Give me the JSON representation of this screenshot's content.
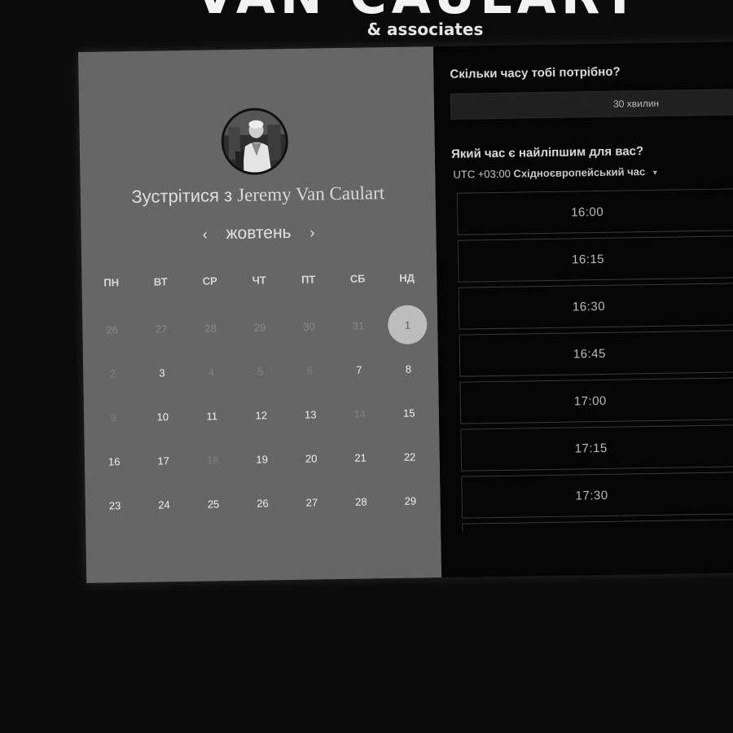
{
  "brand": {
    "title": "VAN CAULART",
    "subtitle": "& associates"
  },
  "booking": {
    "title_prefix": "Зустрітися з",
    "host_name": "Jeremy Van Caulart",
    "month": "жовтень",
    "prev_icon": "chevron-left-icon",
    "next_icon": "chevron-right-icon",
    "weekdays": [
      "ПН",
      "ВТ",
      "СР",
      "ЧТ",
      "ПТ",
      "СБ",
      "НД"
    ],
    "weeks": [
      [
        {
          "d": "26",
          "state": "muted"
        },
        {
          "d": "27",
          "state": "muted"
        },
        {
          "d": "28",
          "state": "muted"
        },
        {
          "d": "29",
          "state": "muted"
        },
        {
          "d": "30",
          "state": "muted"
        },
        {
          "d": "31",
          "state": "muted"
        },
        {
          "d": "1",
          "state": "selected"
        }
      ],
      [
        {
          "d": "2",
          "state": "disabled"
        },
        {
          "d": "3",
          "state": "available"
        },
        {
          "d": "4",
          "state": "disabled"
        },
        {
          "d": "5",
          "state": "disabled"
        },
        {
          "d": "6",
          "state": "disabled"
        },
        {
          "d": "7",
          "state": "available"
        },
        {
          "d": "8",
          "state": "available"
        }
      ],
      [
        {
          "d": "9",
          "state": "disabled"
        },
        {
          "d": "10",
          "state": "available"
        },
        {
          "d": "11",
          "state": "available"
        },
        {
          "d": "12",
          "state": "available"
        },
        {
          "d": "13",
          "state": "available"
        },
        {
          "d": "14",
          "state": "disabled"
        },
        {
          "d": "15",
          "state": "available"
        }
      ],
      [
        {
          "d": "16",
          "state": "available"
        },
        {
          "d": "17",
          "state": "available"
        },
        {
          "d": "18",
          "state": "disabled"
        },
        {
          "d": "19",
          "state": "available"
        },
        {
          "d": "20",
          "state": "available"
        },
        {
          "d": "21",
          "state": "available"
        },
        {
          "d": "22",
          "state": "available"
        }
      ],
      [
        {
          "d": "23",
          "state": "available"
        },
        {
          "d": "24",
          "state": "available"
        },
        {
          "d": "25",
          "state": "available"
        },
        {
          "d": "26",
          "state": "available"
        },
        {
          "d": "27",
          "state": "available"
        },
        {
          "d": "28",
          "state": "available"
        },
        {
          "d": "29",
          "state": "available"
        }
      ]
    ]
  },
  "scheduling": {
    "duration_question": "Скільки часу тобі потрібно?",
    "duration_value": "30 хвилин",
    "time_question": "Який час є найліпшим для вас?",
    "tz_offset": "UTC +03:00",
    "tz_name": "Східноєвропейський час",
    "tz_caret_icon": "caret-down-icon",
    "slots": [
      "16:00",
      "16:15",
      "16:30",
      "16:45",
      "17:00",
      "17:15",
      "17:30",
      ""
    ]
  },
  "colors": {
    "page_bg": "#0b0b0b",
    "calendar_panel": "#666666",
    "schedule_panel": "#050505",
    "selected_day": "#bdbdbd"
  }
}
